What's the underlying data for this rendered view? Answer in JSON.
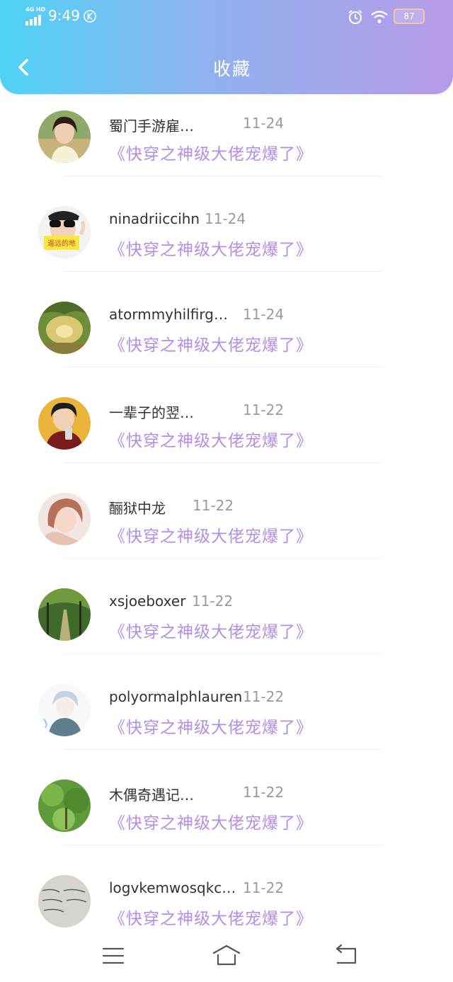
{
  "status_bar": {
    "network": "4G HD",
    "time": "9:49",
    "battery": "87",
    "icons": [
      "signal-icon",
      "k-icon",
      "alarm-icon",
      "wifi-icon",
      "battery-icon"
    ]
  },
  "header": {
    "title": "收藏",
    "back_icon": "chevron-left-icon",
    "gradient_start": "#4fd3f6",
    "gradient_end": "#b79ae8"
  },
  "colors": {
    "book_title": "#b38ee6",
    "date": "#9a9a9a",
    "username": "#333333"
  },
  "favorites": [
    {
      "username": "蜀门手游雇…",
      "date": "11-24",
      "book": "《快穿之神级大佬宠爆了》"
    },
    {
      "username": "ninadriiccihn",
      "date": "11-24",
      "book": "《快穿之神级大佬宠爆了》"
    },
    {
      "username": "atormmyhilfirg…",
      "date": "11-24",
      "book": "《快穿之神级大佬宠爆了》"
    },
    {
      "username": "一辈子的翌…",
      "date": "11-22",
      "book": "《快穿之神级大佬宠爆了》"
    },
    {
      "username": "酾狱中龙",
      "date": "11-22",
      "book": "《快穿之神级大佬宠爆了》"
    },
    {
      "username": "xsjoeboxer",
      "date": "11-22",
      "book": "《快穿之神级大佬宠爆了》"
    },
    {
      "username": "polyormalphlauren",
      "date": "11-22",
      "book": "《快穿之神级大佬宠爆了》"
    },
    {
      "username": "木偶奇遇记…",
      "date": "11-22",
      "book": "《快穿之神级大佬宠爆了》"
    },
    {
      "username": "logvkemwosqkc…",
      "date": "11-22",
      "book": "《快穿之神级大佬宠爆了》"
    }
  ],
  "avatar_text": {
    "item_2": "遥远的地"
  },
  "bottom_nav": {
    "icons": [
      "menu-icon",
      "home-icon",
      "back-icon"
    ]
  }
}
